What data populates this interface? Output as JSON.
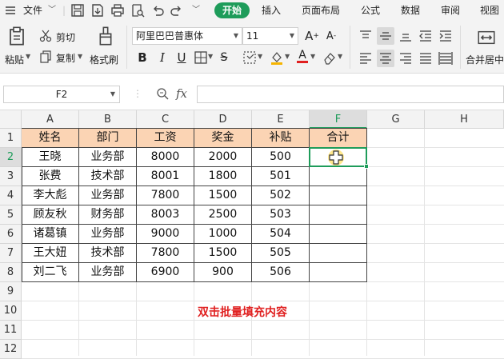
{
  "menubar": {
    "file_menu": "文件",
    "tabs": [
      "开始",
      "插入",
      "页面布局",
      "公式",
      "数据",
      "审阅",
      "视图"
    ],
    "active_tab": "开始"
  },
  "ribbon": {
    "paste": "粘贴",
    "cut": "剪切",
    "copy": "复制",
    "format_painter": "格式刷",
    "font_name": "阿里巴巴普惠体",
    "font_size": "11",
    "merge_center": "合并居中"
  },
  "formula_bar": {
    "name_box": "F2",
    "fx_label": "fx",
    "content": ""
  },
  "sheet": {
    "columns": [
      "A",
      "B",
      "C",
      "D",
      "E",
      "F",
      "G",
      "H"
    ],
    "rows": [
      "1",
      "2",
      "3",
      "4",
      "5",
      "6",
      "7",
      "8",
      "9",
      "10",
      "11",
      "12"
    ],
    "active_cell": "F2",
    "header_fill": "#fbd4b4",
    "accent": "#1e9c5a",
    "table_header": [
      "姓名",
      "部门",
      "工资",
      "奖金",
      "补贴",
      "合计"
    ],
    "table_rows": [
      [
        "王晓",
        "业务部",
        "8000",
        "2000",
        "500",
        ""
      ],
      [
        "张费",
        "技术部",
        "8001",
        "1800",
        "501",
        ""
      ],
      [
        "李大彪",
        "业务部",
        "7800",
        "1500",
        "502",
        ""
      ],
      [
        "顾友秋",
        "财务部",
        "8003",
        "2500",
        "503",
        ""
      ],
      [
        "诸葛镇",
        "业务部",
        "9000",
        "1000",
        "504",
        ""
      ],
      [
        "王大妞",
        "技术部",
        "7800",
        "1500",
        "505",
        ""
      ],
      [
        "刘二飞",
        "业务部",
        "6900",
        "900",
        "506",
        ""
      ]
    ],
    "annotation": "双击批量填充内容",
    "annotation_color": "#e02020"
  }
}
